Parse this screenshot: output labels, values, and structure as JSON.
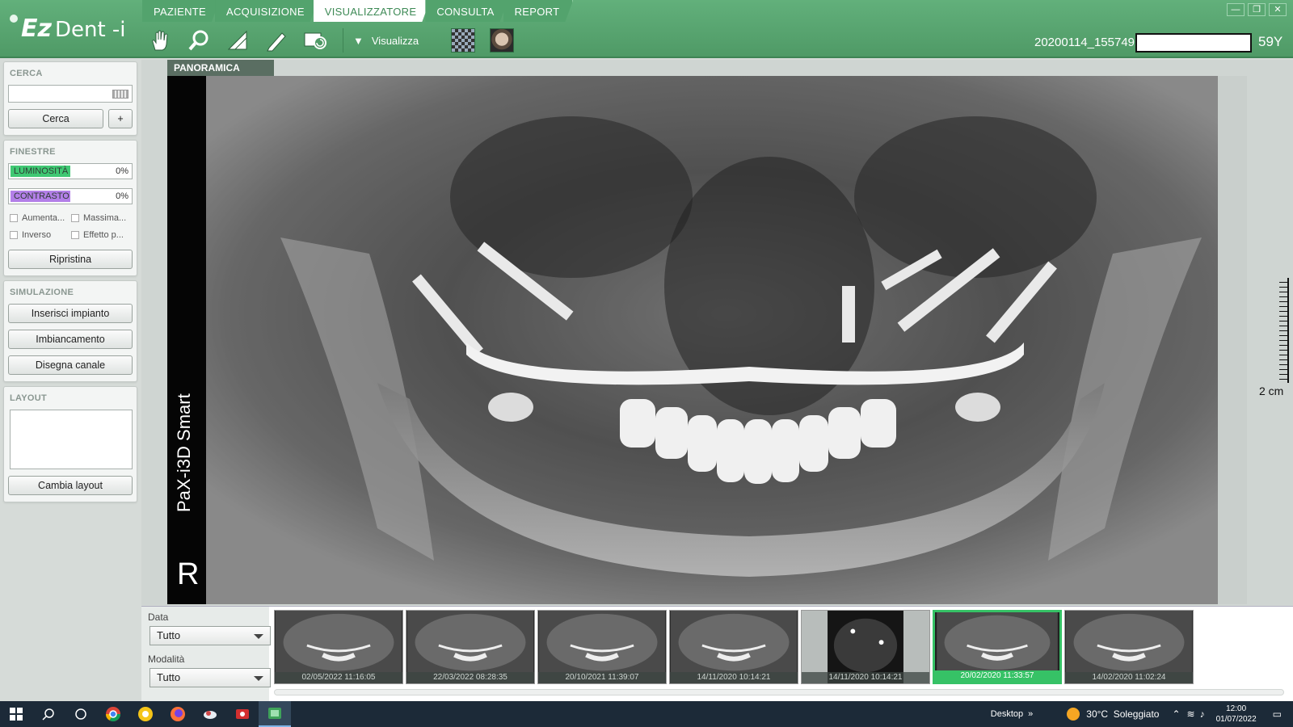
{
  "app": {
    "logo_ez": "Ez",
    "logo_dent": "Dent -i"
  },
  "tabs": [
    {
      "label": "PAZIENTE"
    },
    {
      "label": "ACQUISIZIONE"
    },
    {
      "label": "VISUALIZZATORE",
      "active": true
    },
    {
      "label": "CONSULTA"
    },
    {
      "label": "REPORT"
    }
  ],
  "window_controls": {
    "minimize": "—",
    "restore": "❐",
    "close": "✕"
  },
  "toolbar": {
    "tools": [
      "hand-icon",
      "magnifier-icon",
      "angle-measure-icon",
      "pencil-icon",
      "rotate-image-icon"
    ],
    "visualizza_label": "Visualizza"
  },
  "patient": {
    "id": "20200114_155749",
    "name": "",
    "age": "59Y"
  },
  "search": {
    "title": "CERCA",
    "value": "",
    "search_label": "Cerca",
    "add_label": "+"
  },
  "windows": {
    "title": "FINESTRE",
    "brightness": {
      "label": "LUMINOSITÀ",
      "value": "0%",
      "color": "#3fc873"
    },
    "contrast": {
      "label": "CONTRASTO",
      "value": "0%",
      "color": "#b37fe8"
    },
    "checkboxes": [
      {
        "label": "Aumenta..."
      },
      {
        "label": "Massima..."
      },
      {
        "label": "Inverso"
      },
      {
        "label": "Effetto p..."
      }
    ],
    "reset_label": "Ripristina"
  },
  "simulation": {
    "title": "SIMULAZIONE",
    "buttons": [
      "Inserisci impianto",
      "Imbiancamento",
      "Disegna canale"
    ]
  },
  "layout": {
    "title": "LAYOUT",
    "change_label": "Cambia layout"
  },
  "viewer": {
    "tag": "PANORAMICA",
    "device": "PaX-i3D Smart",
    "side_marker": "R",
    "scale": "2 cm"
  },
  "filters": {
    "date_label": "Data",
    "date_value": "Tutto",
    "modality_label": "Modalità",
    "modality_value": "Tutto"
  },
  "thumbnails": [
    {
      "date": "02/05/2022 11:16:05",
      "kind": "pano"
    },
    {
      "date": "22/03/2022 08:28:35",
      "kind": "pano"
    },
    {
      "date": "20/10/2021 11:39:07",
      "kind": "pano"
    },
    {
      "date": "14/11/2020 10:14:21",
      "kind": "pano"
    },
    {
      "date": "14/11/2020 10:14:21",
      "kind": "ct"
    },
    {
      "date": "20/02/2020 11:33:57",
      "kind": "pano",
      "selected": true
    },
    {
      "date": "14/02/2020 11:02:24",
      "kind": "pano"
    }
  ],
  "taskbar": {
    "apps": [
      "windows-start-icon",
      "search-icon",
      "task-view-icon",
      "chrome-icon",
      "yellow-app-icon",
      "firefox-icon",
      "cloud-app-icon",
      "video-app-icon",
      "ezdent-app-icon"
    ],
    "desktop_label": "Desktop",
    "weather": "30°C  Soleggiato",
    "time": "12:00",
    "date": "01/07/2022"
  }
}
